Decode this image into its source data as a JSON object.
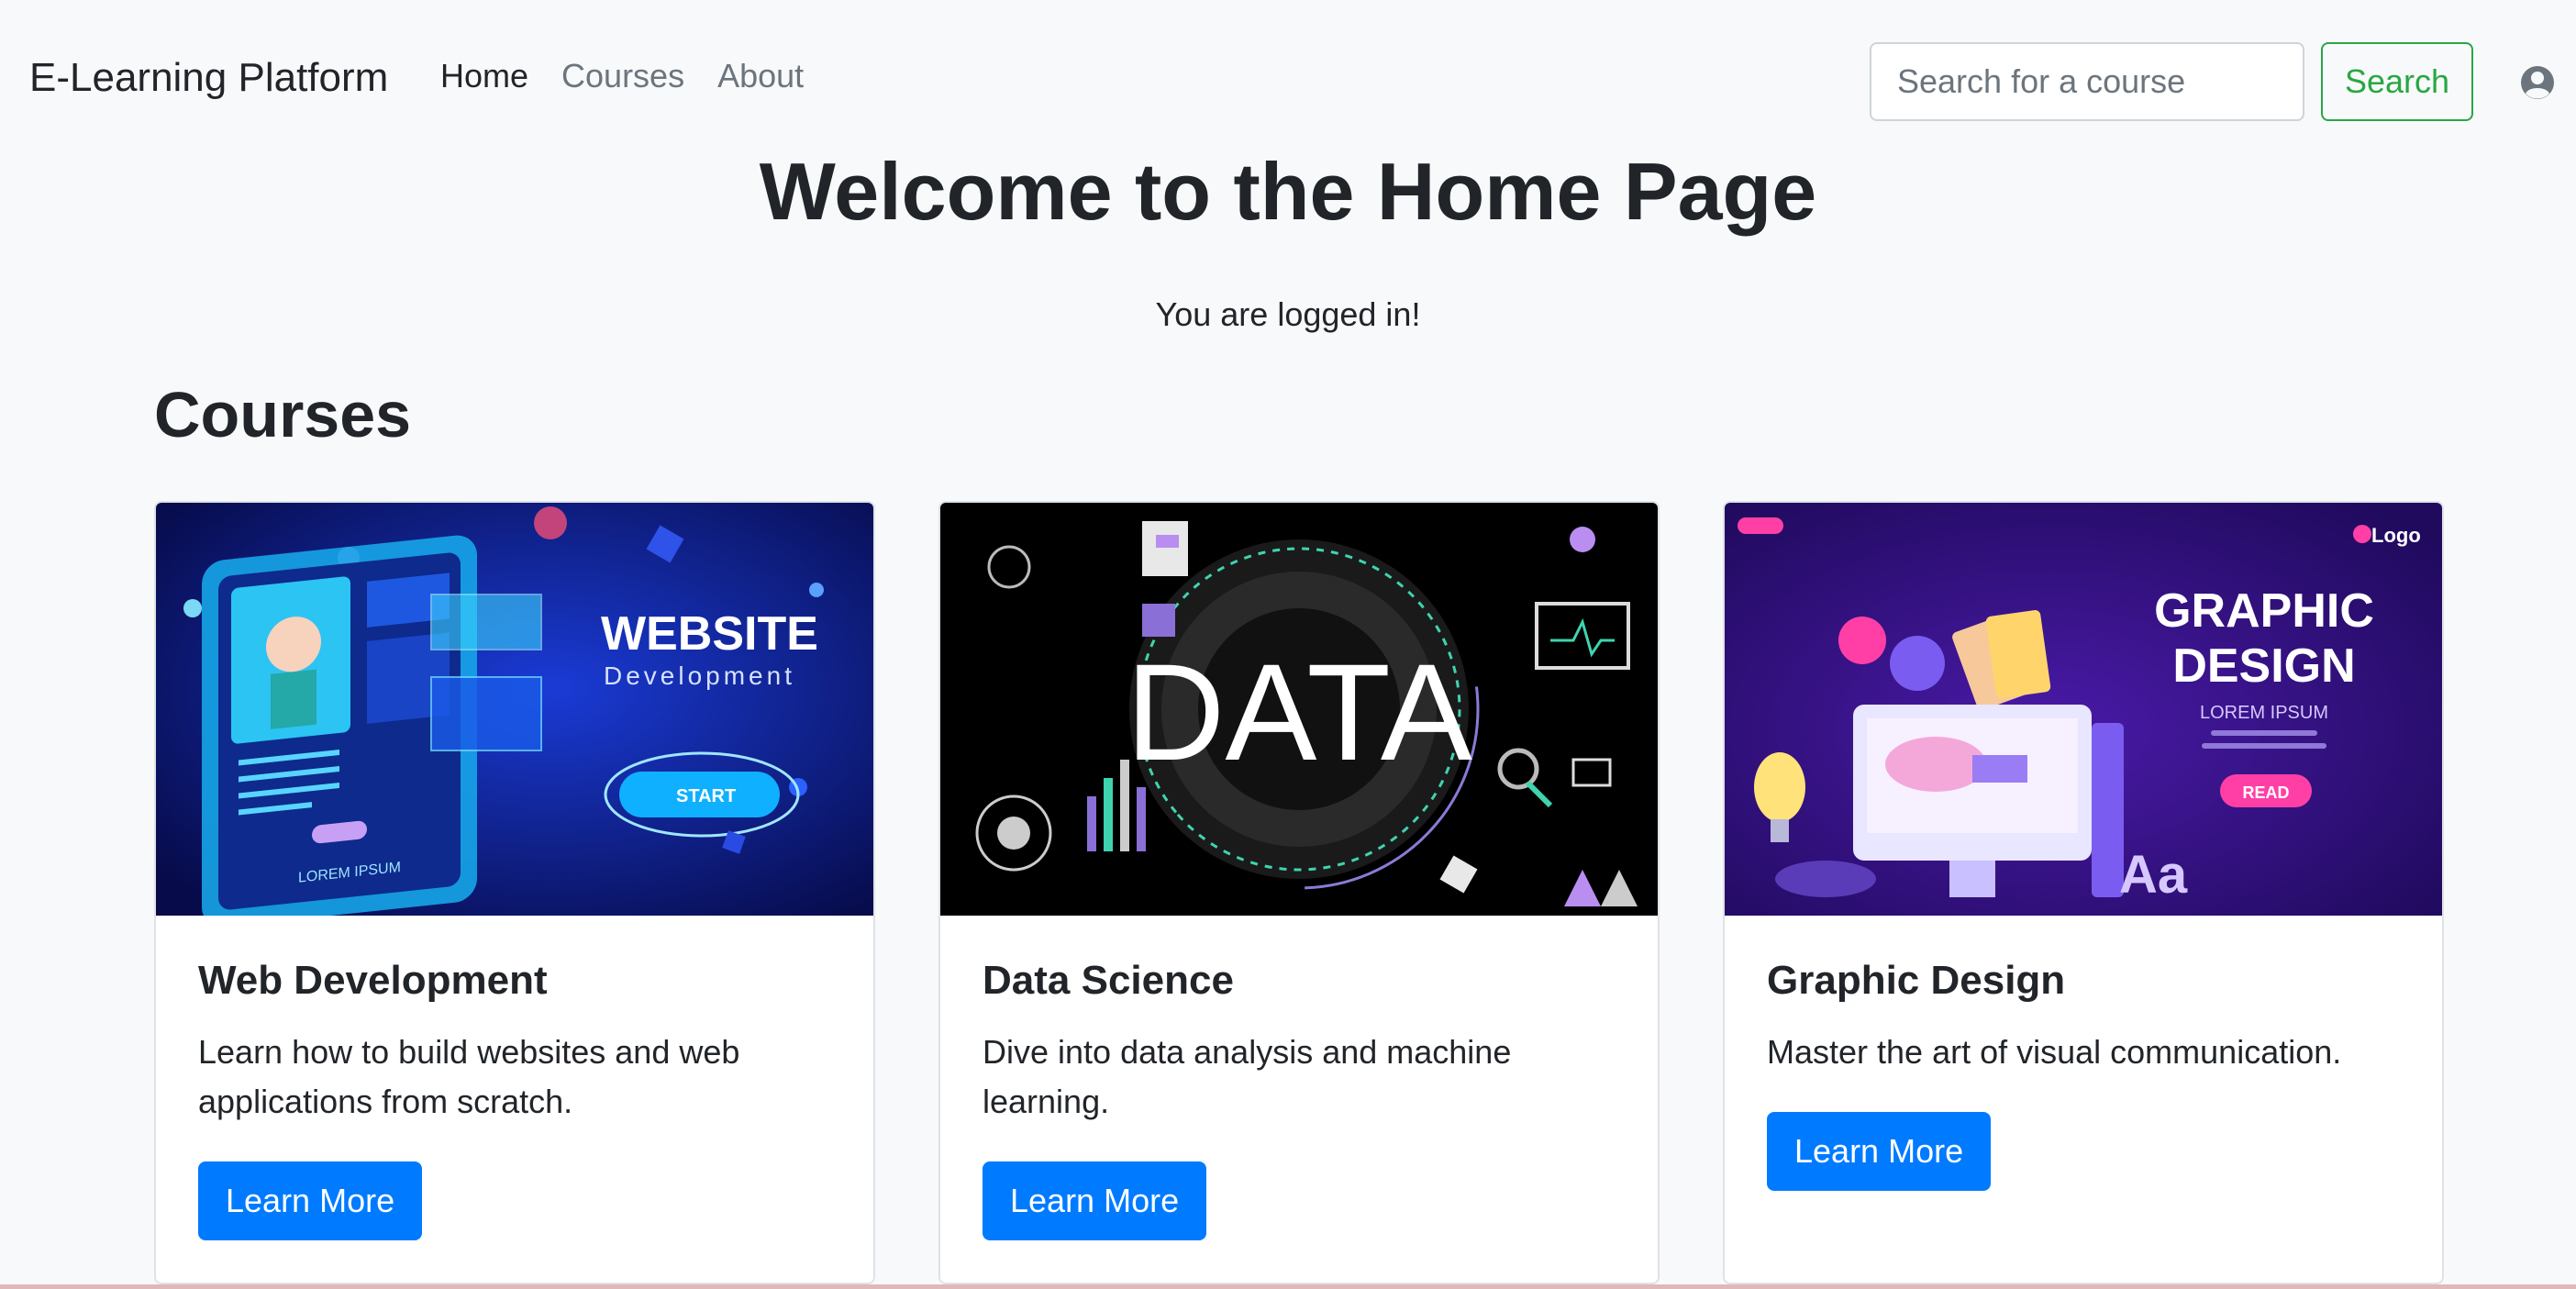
{
  "navbar": {
    "brand": "E-Learning Platform",
    "links": [
      "Home",
      "Courses",
      "About"
    ],
    "search_placeholder": "Search for a course",
    "search_button": "Search",
    "user_icon": "user-circle-icon"
  },
  "hero": {
    "title": "Welcome to the Home Page",
    "subtitle": "You are logged in!"
  },
  "courses": {
    "heading": "Courses",
    "items": [
      {
        "title": "Web Development",
        "description": "Learn how to build websites and web applications from scratch.",
        "button": "Learn More",
        "image": {
          "heading": "WEBSITE",
          "subheading": "Development",
          "button": "START",
          "caption": "LOREM IPSUM"
        }
      },
      {
        "title": "Data Science",
        "description": "Dive into data analysis and machine learning.",
        "button": "Learn More",
        "image": {
          "heading": "DATA"
        }
      },
      {
        "title": "Graphic Design",
        "description": "Master the art of visual communication.",
        "button": "Learn More",
        "image": {
          "heading_line1": "GRAPHIC",
          "heading_line2": "DESIGN",
          "subheading": "LOREM IPSUM",
          "button": "READ",
          "logo": "Logo",
          "sample_text": "Aa"
        }
      }
    ]
  },
  "colors": {
    "primary": "#007bff",
    "success": "#28a745",
    "muted": "#6c757d",
    "background": "#f8f9fa"
  }
}
